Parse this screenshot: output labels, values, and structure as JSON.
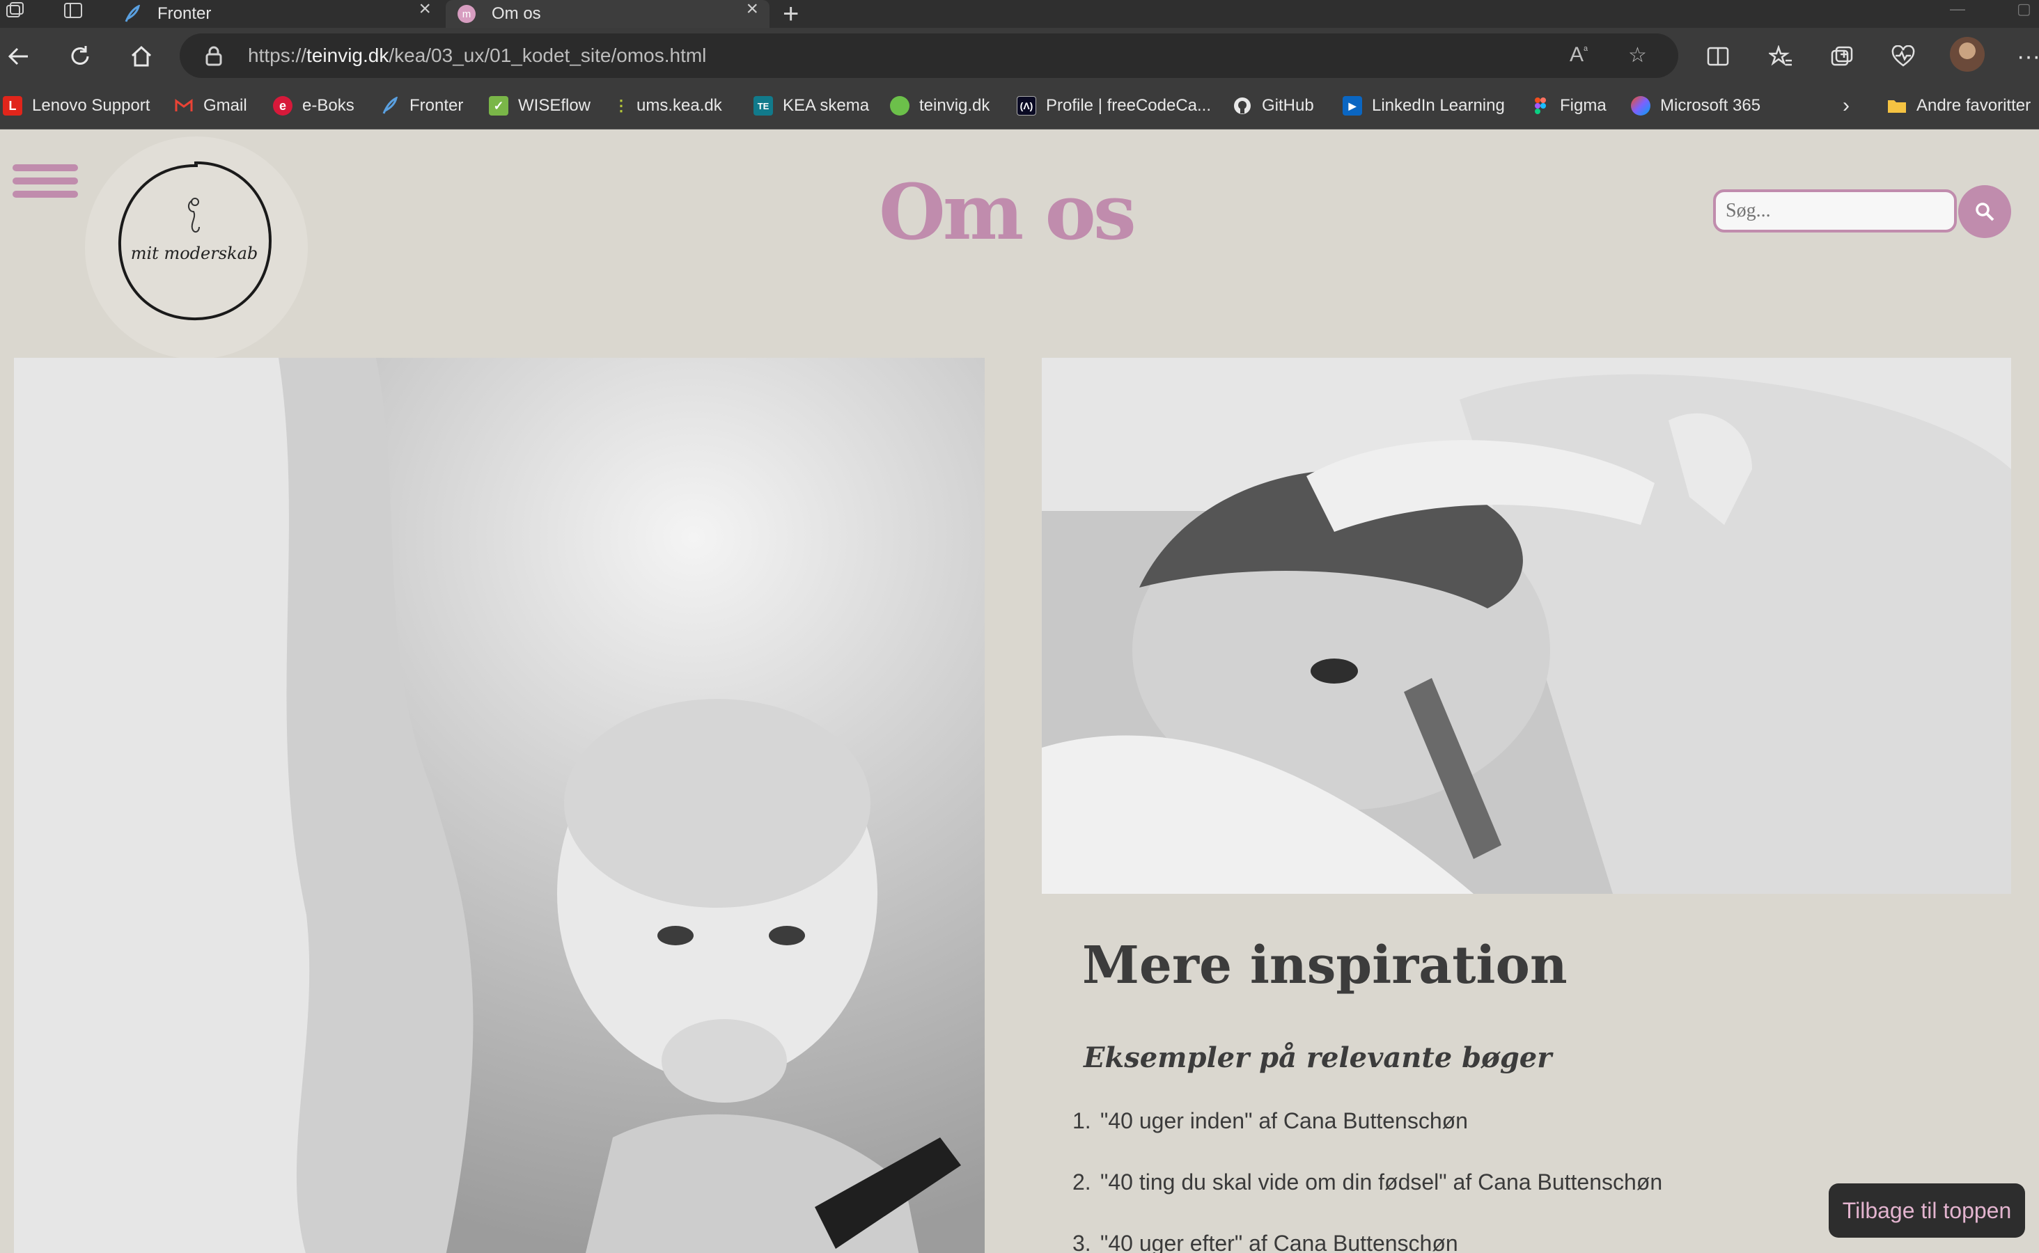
{
  "tabs": [
    {
      "title": "Fronter",
      "favicon": "fronter-feather-icon"
    },
    {
      "title": "Om os",
      "favicon": "mit-moderskab-favicon",
      "active": true
    }
  ],
  "address_bar": {
    "url_prefix": "https://",
    "url_domain": "teinvig.dk",
    "url_path": "/kea/03_ux/01_kodet_site/omos.html"
  },
  "bookmarks": [
    {
      "label": "Lenovo Support",
      "icon": "lenovo-icon",
      "color": "#e1251b"
    },
    {
      "label": "Gmail",
      "icon": "gmail-icon",
      "color": "#ea4335"
    },
    {
      "label": "e-Boks",
      "icon": "eboks-icon",
      "color": "#d7193a"
    },
    {
      "label": "Fronter",
      "icon": "fronter-feather-icon",
      "color": "#5aa0e0"
    },
    {
      "label": "WISEflow",
      "icon": "wiseflow-icon",
      "color": "#7ab648"
    },
    {
      "label": "ums.kea.dk",
      "icon": "dots-icon",
      "color": "#b7c93a"
    },
    {
      "label": "KEA skema",
      "icon": "te-icon",
      "color": "#117a8b"
    },
    {
      "label": "teinvig.dk",
      "icon": "green-dot-icon",
      "color": "#6cc04a"
    },
    {
      "label": "Profile | freeCodeCa...",
      "icon": "freecodecamp-icon",
      "color": "#0a0a23"
    },
    {
      "label": "GitHub",
      "icon": "github-icon",
      "color": "#ffffff"
    },
    {
      "label": "LinkedIn Learning",
      "icon": "linkedin-learning-icon",
      "color": "#0a66c2"
    },
    {
      "label": "Figma",
      "icon": "figma-icon",
      "color": "#f24e1e"
    },
    {
      "label": "Microsoft 365",
      "icon": "microsoft365-icon",
      "color": "#7b61ff"
    }
  ],
  "bookmarks_overflow": "Andre favoritter",
  "site": {
    "logo_text": "mit moderskab",
    "page_title": "Om os",
    "search_placeholder": "Søg...",
    "accent_color": "#c08cad",
    "background_color": "#dad7cf"
  },
  "inspiration": {
    "title": "Mere inspiration",
    "subtitle": "Eksempler på relevante bøger",
    "books": [
      {
        "num": "1.",
        "text": "\"40 uger inden\" af Cana Buttenschøn"
      },
      {
        "num": "2.",
        "text": "\"40 ting du skal vide om din fødsel\" af Cana Buttenschøn"
      },
      {
        "num": "3.",
        "text": "\"40 uger efter\" af Cana Buttenschøn"
      }
    ]
  },
  "back_to_top_label": "Tilbage til toppen"
}
